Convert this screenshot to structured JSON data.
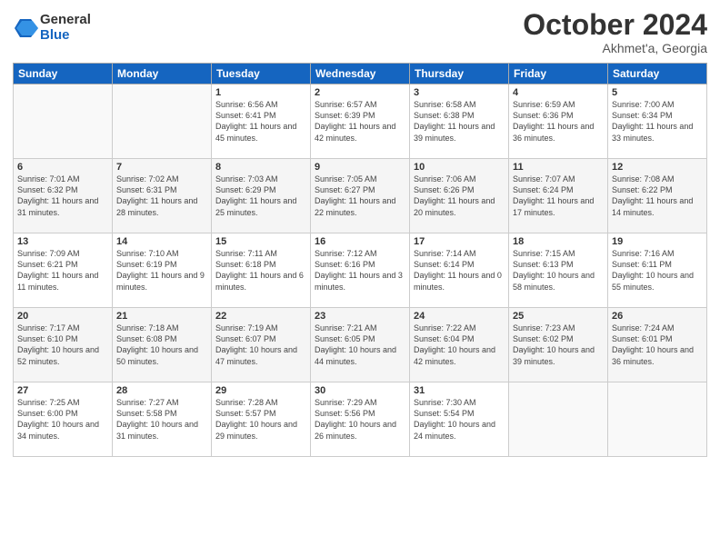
{
  "header": {
    "logo": {
      "general": "General",
      "blue": "Blue"
    },
    "title": "October 2024",
    "location": "Akhmet'a, Georgia"
  },
  "weekdays": [
    "Sunday",
    "Monday",
    "Tuesday",
    "Wednesday",
    "Thursday",
    "Friday",
    "Saturday"
  ],
  "weeks": [
    [
      {
        "day": "",
        "info": ""
      },
      {
        "day": "",
        "info": ""
      },
      {
        "day": "1",
        "info": "Sunrise: 6:56 AM\nSunset: 6:41 PM\nDaylight: 11 hours and 45 minutes."
      },
      {
        "day": "2",
        "info": "Sunrise: 6:57 AM\nSunset: 6:39 PM\nDaylight: 11 hours and 42 minutes."
      },
      {
        "day": "3",
        "info": "Sunrise: 6:58 AM\nSunset: 6:38 PM\nDaylight: 11 hours and 39 minutes."
      },
      {
        "day": "4",
        "info": "Sunrise: 6:59 AM\nSunset: 6:36 PM\nDaylight: 11 hours and 36 minutes."
      },
      {
        "day": "5",
        "info": "Sunrise: 7:00 AM\nSunset: 6:34 PM\nDaylight: 11 hours and 33 minutes."
      }
    ],
    [
      {
        "day": "6",
        "info": "Sunrise: 7:01 AM\nSunset: 6:32 PM\nDaylight: 11 hours and 31 minutes."
      },
      {
        "day": "7",
        "info": "Sunrise: 7:02 AM\nSunset: 6:31 PM\nDaylight: 11 hours and 28 minutes."
      },
      {
        "day": "8",
        "info": "Sunrise: 7:03 AM\nSunset: 6:29 PM\nDaylight: 11 hours and 25 minutes."
      },
      {
        "day": "9",
        "info": "Sunrise: 7:05 AM\nSunset: 6:27 PM\nDaylight: 11 hours and 22 minutes."
      },
      {
        "day": "10",
        "info": "Sunrise: 7:06 AM\nSunset: 6:26 PM\nDaylight: 11 hours and 20 minutes."
      },
      {
        "day": "11",
        "info": "Sunrise: 7:07 AM\nSunset: 6:24 PM\nDaylight: 11 hours and 17 minutes."
      },
      {
        "day": "12",
        "info": "Sunrise: 7:08 AM\nSunset: 6:22 PM\nDaylight: 11 hours and 14 minutes."
      }
    ],
    [
      {
        "day": "13",
        "info": "Sunrise: 7:09 AM\nSunset: 6:21 PM\nDaylight: 11 hours and 11 minutes."
      },
      {
        "day": "14",
        "info": "Sunrise: 7:10 AM\nSunset: 6:19 PM\nDaylight: 11 hours and 9 minutes."
      },
      {
        "day": "15",
        "info": "Sunrise: 7:11 AM\nSunset: 6:18 PM\nDaylight: 11 hours and 6 minutes."
      },
      {
        "day": "16",
        "info": "Sunrise: 7:12 AM\nSunset: 6:16 PM\nDaylight: 11 hours and 3 minutes."
      },
      {
        "day": "17",
        "info": "Sunrise: 7:14 AM\nSunset: 6:14 PM\nDaylight: 11 hours and 0 minutes."
      },
      {
        "day": "18",
        "info": "Sunrise: 7:15 AM\nSunset: 6:13 PM\nDaylight: 10 hours and 58 minutes."
      },
      {
        "day": "19",
        "info": "Sunrise: 7:16 AM\nSunset: 6:11 PM\nDaylight: 10 hours and 55 minutes."
      }
    ],
    [
      {
        "day": "20",
        "info": "Sunrise: 7:17 AM\nSunset: 6:10 PM\nDaylight: 10 hours and 52 minutes."
      },
      {
        "day": "21",
        "info": "Sunrise: 7:18 AM\nSunset: 6:08 PM\nDaylight: 10 hours and 50 minutes."
      },
      {
        "day": "22",
        "info": "Sunrise: 7:19 AM\nSunset: 6:07 PM\nDaylight: 10 hours and 47 minutes."
      },
      {
        "day": "23",
        "info": "Sunrise: 7:21 AM\nSunset: 6:05 PM\nDaylight: 10 hours and 44 minutes."
      },
      {
        "day": "24",
        "info": "Sunrise: 7:22 AM\nSunset: 6:04 PM\nDaylight: 10 hours and 42 minutes."
      },
      {
        "day": "25",
        "info": "Sunrise: 7:23 AM\nSunset: 6:02 PM\nDaylight: 10 hours and 39 minutes."
      },
      {
        "day": "26",
        "info": "Sunrise: 7:24 AM\nSunset: 6:01 PM\nDaylight: 10 hours and 36 minutes."
      }
    ],
    [
      {
        "day": "27",
        "info": "Sunrise: 7:25 AM\nSunset: 6:00 PM\nDaylight: 10 hours and 34 minutes."
      },
      {
        "day": "28",
        "info": "Sunrise: 7:27 AM\nSunset: 5:58 PM\nDaylight: 10 hours and 31 minutes."
      },
      {
        "day": "29",
        "info": "Sunrise: 7:28 AM\nSunset: 5:57 PM\nDaylight: 10 hours and 29 minutes."
      },
      {
        "day": "30",
        "info": "Sunrise: 7:29 AM\nSunset: 5:56 PM\nDaylight: 10 hours and 26 minutes."
      },
      {
        "day": "31",
        "info": "Sunrise: 7:30 AM\nSunset: 5:54 PM\nDaylight: 10 hours and 24 minutes."
      },
      {
        "day": "",
        "info": ""
      },
      {
        "day": "",
        "info": ""
      }
    ]
  ]
}
